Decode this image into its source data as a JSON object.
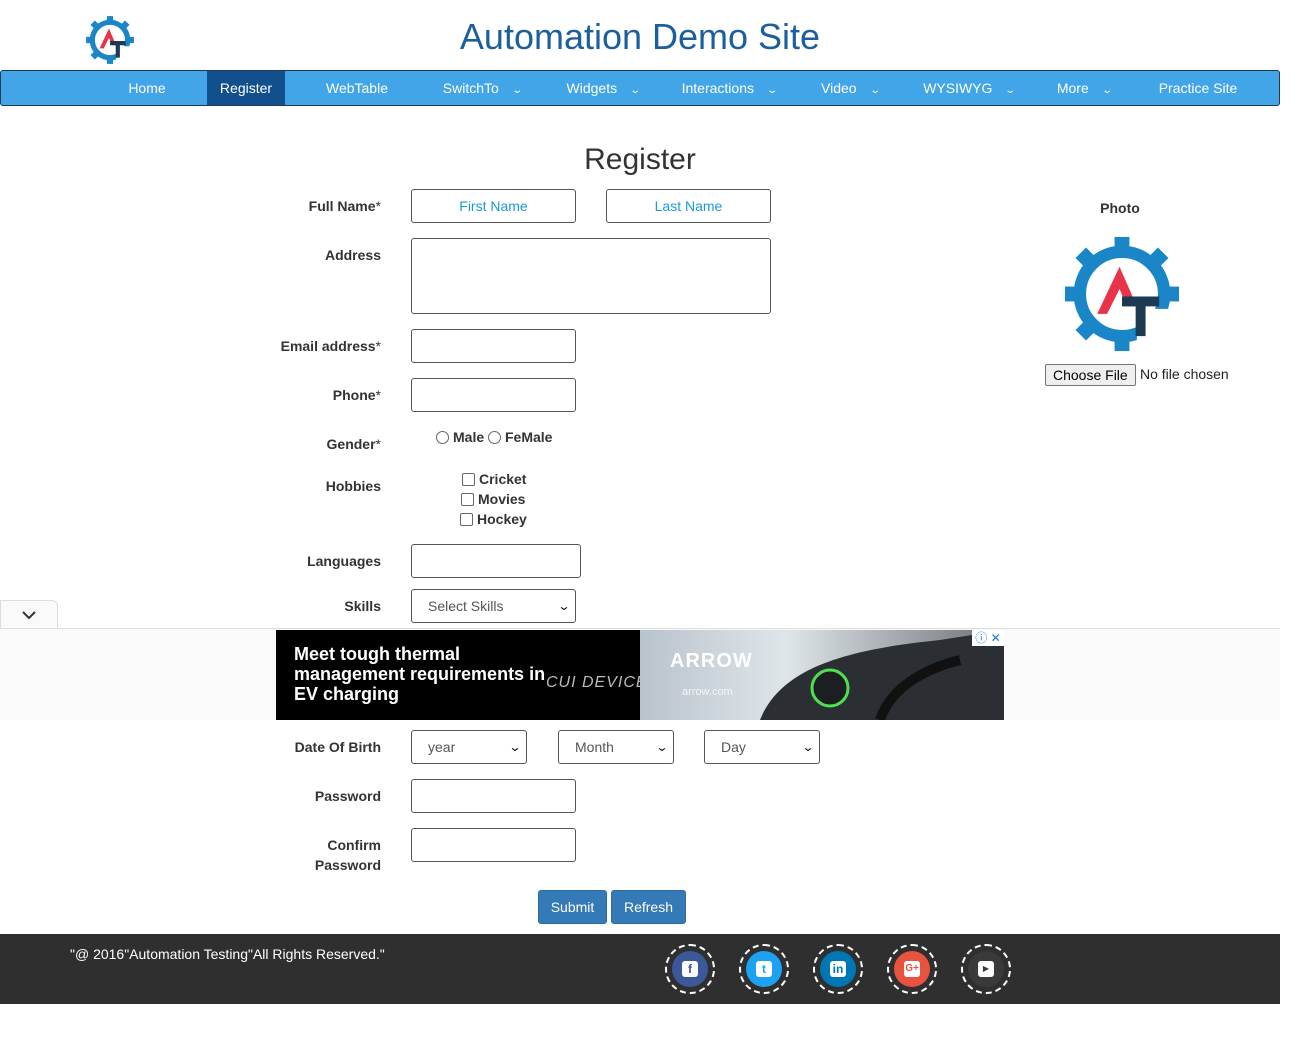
{
  "header": {
    "title": "Automation Demo Site"
  },
  "nav": {
    "items": [
      {
        "label": "Home"
      },
      {
        "label": "Register"
      },
      {
        "label": "WebTable"
      },
      {
        "label": "SwitchTo"
      },
      {
        "label": "Widgets"
      },
      {
        "label": "Interactions"
      },
      {
        "label": "Video"
      },
      {
        "label": "WYSIWYG"
      },
      {
        "label": "More"
      },
      {
        "label": "Practice Site"
      }
    ],
    "active": "Register",
    "colors": {
      "bar": "#42a5e8",
      "active": "#11508d"
    }
  },
  "form": {
    "heading": "Register",
    "full_name_label": "Full Name",
    "first_name_placeholder": "First Name",
    "last_name_placeholder": "Last Name",
    "address_label": "Address",
    "email_label": "Email address",
    "phone_label": "Phone",
    "gender_label": "Gender",
    "gender_options": [
      "Male",
      "FeMale"
    ],
    "hobbies_label": "Hobbies",
    "hobbies": [
      "Cricket",
      "Movies",
      "Hockey"
    ],
    "languages_label": "Languages",
    "skills_label": "Skills",
    "skills_value": "Select Skills",
    "dob_label": "Date Of Birth",
    "dob_year": "year",
    "dob_month": "Month",
    "dob_day": "Day",
    "password_label": "Password",
    "confirm_password_label_1": "Confirm",
    "confirm_password_label_2": "Password",
    "required_mark": "*",
    "submit": "Submit",
    "refresh": "Refresh"
  },
  "photo": {
    "label": "Photo",
    "choose_file": "Choose File",
    "status": "No file chosen"
  },
  "ad": {
    "headline": "Meet tough thermal management requirements in EV charging",
    "brand_left": "CUI DEVICES",
    "brand_right": "ARROW",
    "url": "arrow.com"
  },
  "footer": {
    "copyright": "\"@ 2016\"Automation Testing\"All Rights Reserved.\"",
    "social": [
      {
        "icon": "facebook-icon",
        "color": "#3b5998"
      },
      {
        "icon": "twitter-icon",
        "color": "#1da1f2"
      },
      {
        "icon": "linkedin-icon",
        "color": "#0077b5"
      },
      {
        "icon": "google-plus-icon",
        "color": "#e8533f"
      },
      {
        "icon": "youtube-icon",
        "color": "#3a3a3a"
      }
    ]
  }
}
